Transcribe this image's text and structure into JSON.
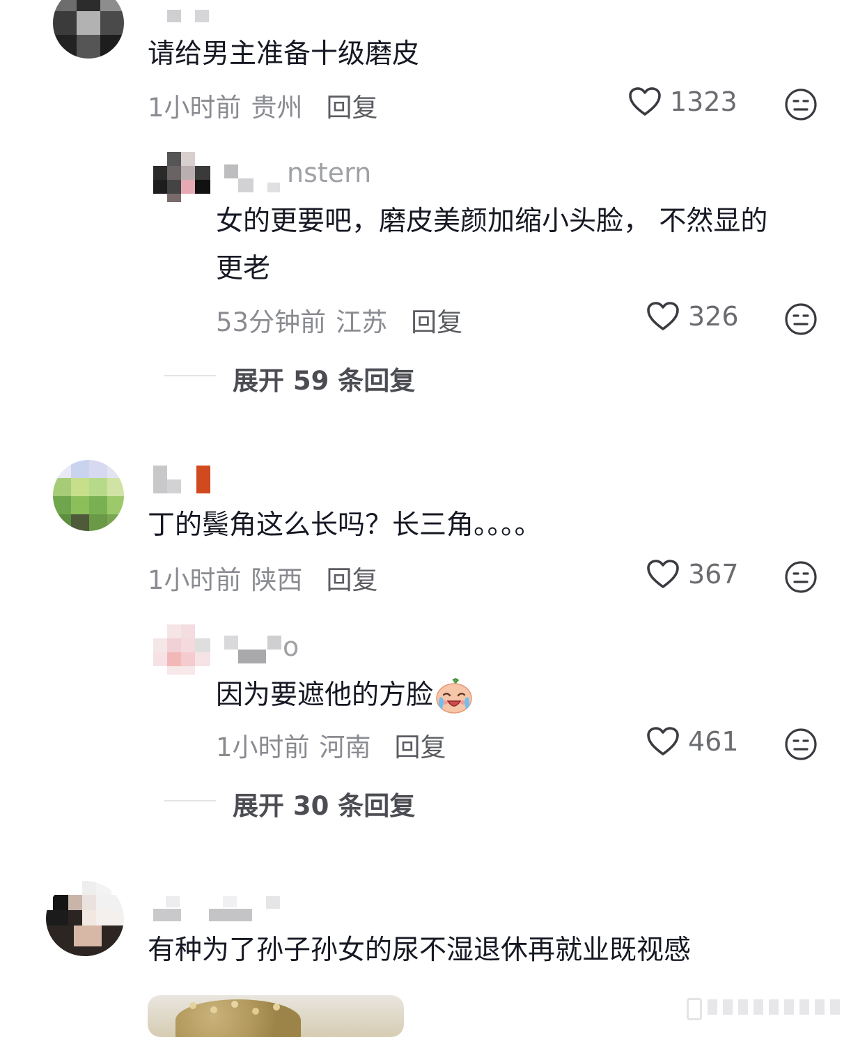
{
  "comments": [
    {
      "text": "请给男主准备十级磨皮",
      "time": "1小时前",
      "location": "贵州",
      "reply_label": "回复",
      "likes": "1323",
      "replies": [
        {
          "username_suffix": "nstern",
          "text_line1": "女的更要吧，磨皮美颜加缩小头脸， 不然显的",
          "text_line2": "更老",
          "time": "53分钟前",
          "location": "江苏",
          "reply_label": "回复",
          "likes": "326"
        }
      ],
      "expand_label": "展开 59 条回复"
    },
    {
      "text": "丁的鬓角这么长吗？长三角。。。。",
      "time": "1小时前",
      "location": "陕西",
      "reply_label": "回复",
      "likes": "367",
      "replies": [
        {
          "username_suffix": "o",
          "text": "因为要遮他的方脸",
          "emoji": "crying-laughing-emoji",
          "time": "1小时前",
          "location": "河南",
          "reply_label": "回复",
          "likes": "461"
        }
      ],
      "expand_label": "展开 30 条回复"
    },
    {
      "text": "有种为了孙子孙女的尿不湿退休再就业既视感"
    }
  ],
  "icons": {
    "like": "heart-outline-icon",
    "dislike": "meh-face-icon"
  },
  "colors": {
    "primary_text": "#161823",
    "meta_text": "#8a8b91",
    "icon_stroke": "#3a3b40"
  }
}
